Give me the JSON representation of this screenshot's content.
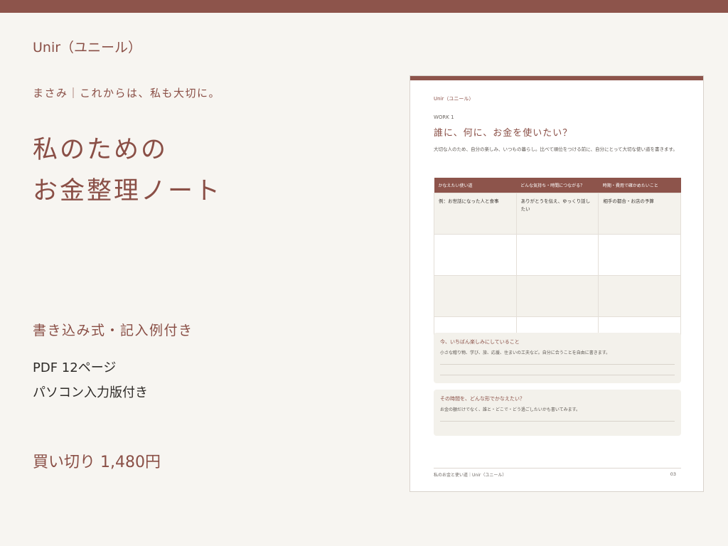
{
  "brand": "Unir（ユニール）",
  "tagline": "まさみ｜これからは、私も大切に。",
  "title_lines": [
    "私のための",
    "お金整理ノート"
  ],
  "feature": "書き込み式・記入例付き",
  "specs": [
    "PDF 12ページ",
    "パソコン入力版付き"
  ],
  "price": "買い切り  1,480円",
  "colors": {
    "accent": "#8d544b",
    "background": "#f7f5f1",
    "panel": "#f3f1eb"
  },
  "preview": {
    "brand": "Unir（ユニール）",
    "work_label": "WORK 1",
    "title": "誰に、何に、お金を使いたい？",
    "description": "大切な人のため、自分の楽しみ、いつもの暮らし。比べて順位をつける前に、自分にとって大切な使い道を書きます。",
    "table": {
      "headers": [
        "かなえたい使い道",
        "どんな気持ち・時間につながる？",
        "時期・費用で確かめたいこと"
      ],
      "example": [
        "例：お世話になった人と食事",
        "ありがとうを伝え、ゆっくり話したい",
        "相手の都合・お店の予算"
      ]
    },
    "box1": {
      "title": "今、いちばん楽しみにしていること",
      "desc": "小さな贈り物、学び、旅、応援、住まいの工夫など。自分に合うことを自由に書きます。"
    },
    "box2": {
      "title": "その時間を、どんな形でかなえたい？",
      "desc": "お金の額だけでなく、誰と・どこで・どう過ごしたいかも書いてみます。"
    },
    "footer": "私のお金と使い道｜Unir（ユニール）",
    "page_number": "03"
  }
}
